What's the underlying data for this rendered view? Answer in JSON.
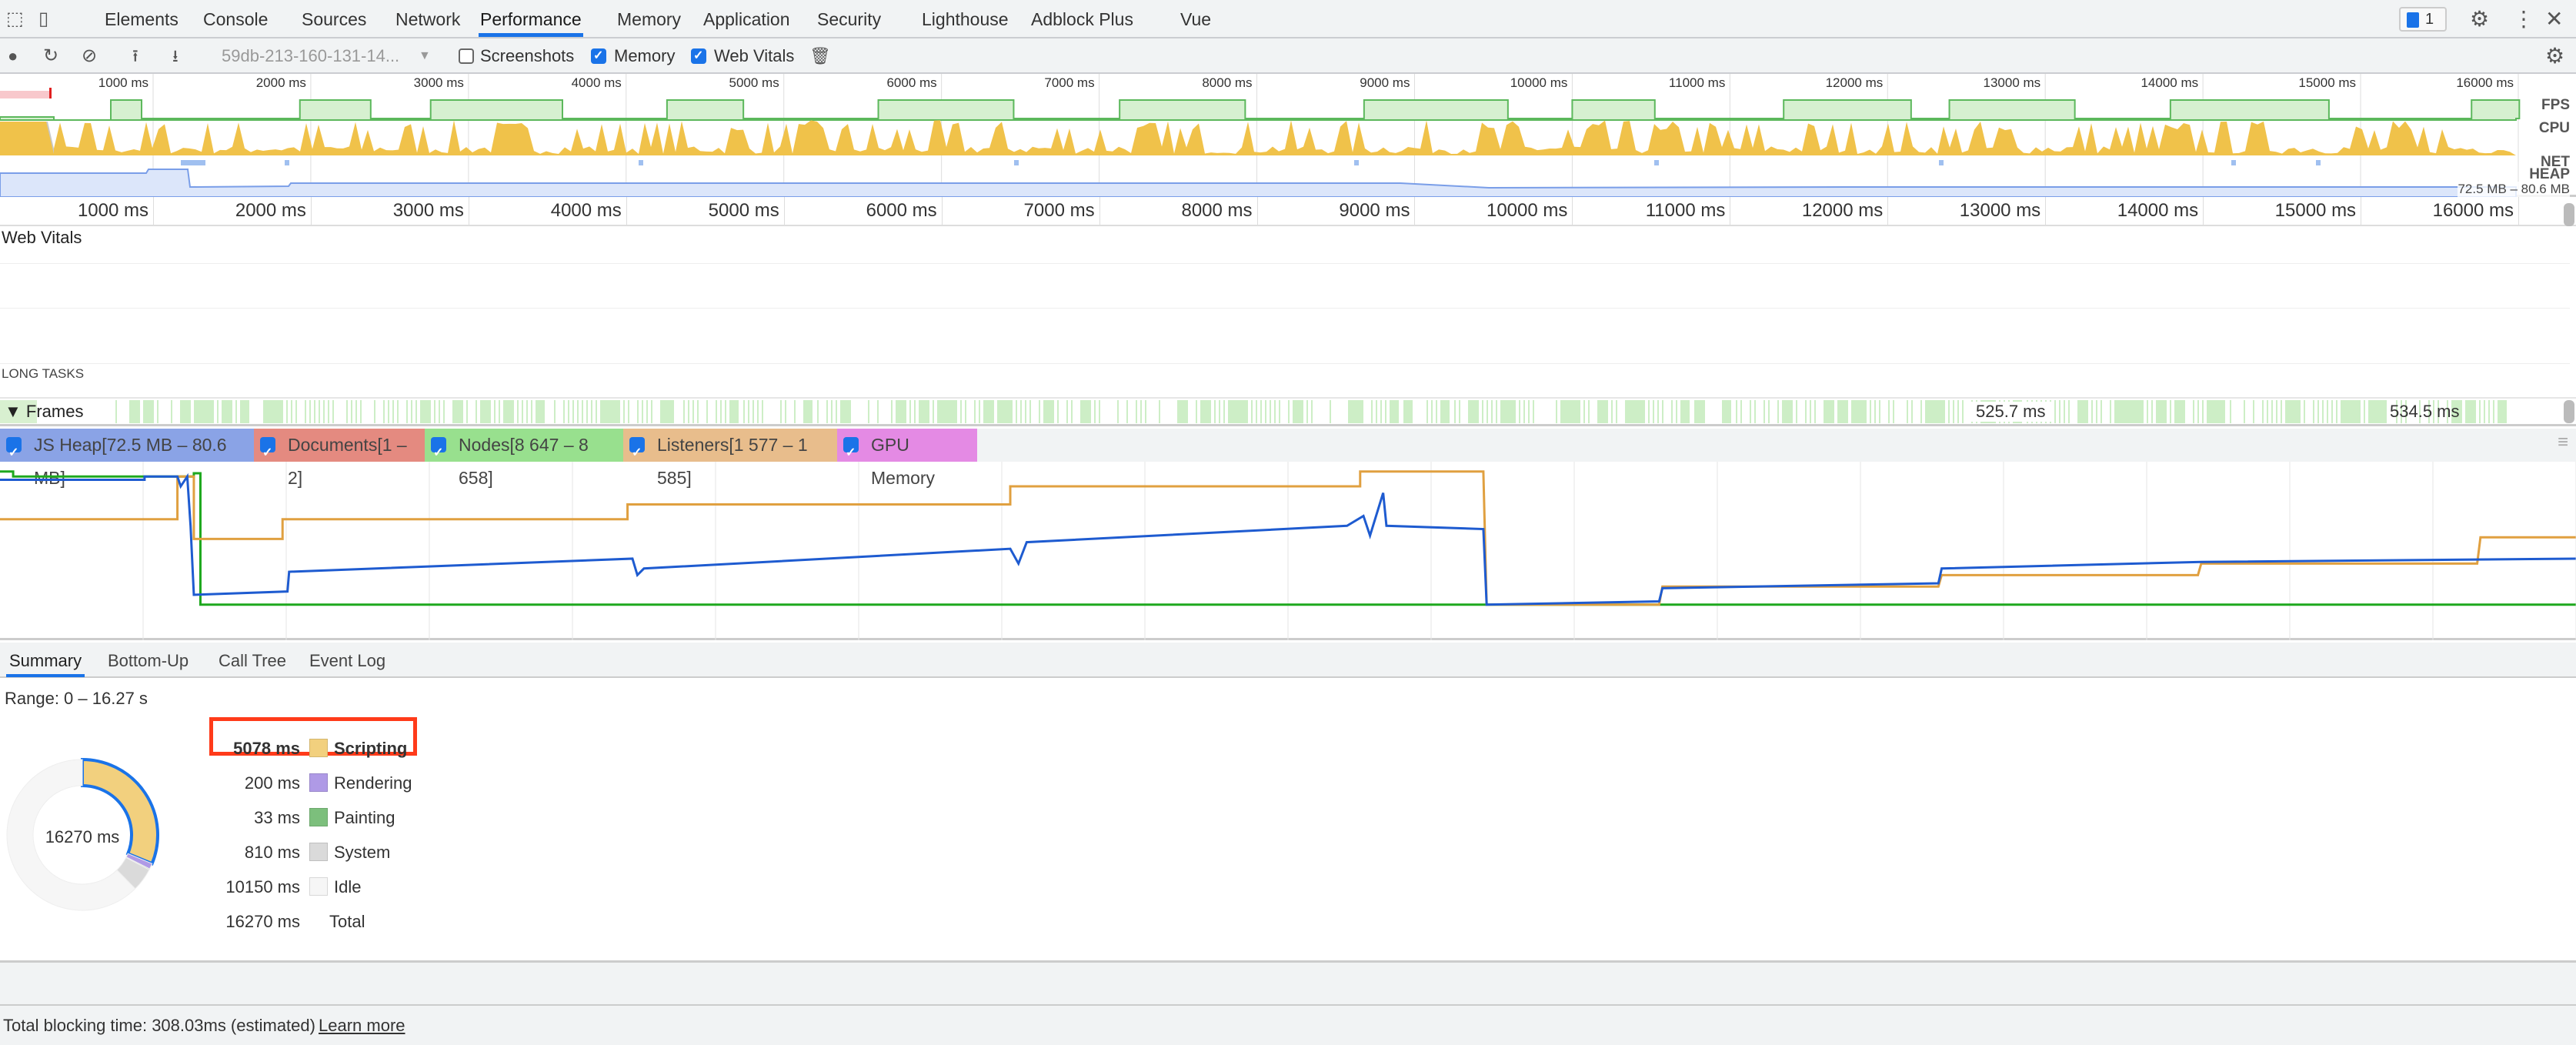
{
  "devtools_tabs": [
    "Elements",
    "Console",
    "Sources",
    "Network",
    "Performance",
    "Memory",
    "Application",
    "Security",
    "Lighthouse",
    "Adblock Plus",
    "Vue"
  ],
  "active_tab": "Performance",
  "issues_badge": "1",
  "toolbar": {
    "profile_select": "59db-213-160-131-14...",
    "screenshots_label": "Screenshots",
    "screenshots_checked": false,
    "memory_label": "Memory",
    "memory_checked": true,
    "web_vitals_label": "Web Vitals",
    "web_vitals_checked": true
  },
  "overview": {
    "ticks": [
      "1000 ms",
      "2000 ms",
      "3000 ms",
      "4000 ms",
      "5000 ms",
      "6000 ms",
      "7000 ms",
      "8000 ms",
      "9000 ms",
      "10000 ms",
      "11000 ms",
      "12000 ms",
      "13000 ms",
      "14000 ms",
      "15000 ms",
      "16000 ms"
    ],
    "tracks": {
      "fps": "FPS",
      "cpu": "CPU",
      "net": "NET",
      "heap": "HEAP"
    },
    "heap_range": "72.5 MB – 80.6 MB",
    "colors": {
      "fps": "#5cb85c",
      "scripting": "#f0c24a",
      "system": "#c8c8c8",
      "heap": "#7a9ee8"
    }
  },
  "main": {
    "ticks": [
      "1000 ms",
      "2000 ms",
      "3000 ms",
      "4000 ms",
      "5000 ms",
      "6000 ms",
      "7000 ms",
      "8000 ms",
      "9000 ms",
      "10000 ms",
      "11000 ms",
      "12000 ms",
      "13000 ms",
      "14000 ms",
      "15000 ms",
      "16000 ms"
    ],
    "web_vitals_label": "Web Vitals",
    "long_tasks_label": "LONG TASKS",
    "frames_label": "Frames",
    "frame_durations": [
      "525.7 ms",
      "534.5 ms"
    ]
  },
  "memory_counters": [
    {
      "label": "JS Heap[72.5 MB – 80.6 MB]",
      "color": "#8aa3e6",
      "line": "#1e5bd0",
      "checked": true
    },
    {
      "label": "Documents[1 – 2]",
      "color": "#e48a80",
      "line": "#d0443a",
      "checked": true
    },
    {
      "label": "Nodes[8 647 – 8 658]",
      "color": "#98e08e",
      "line": "#1ea81e",
      "checked": true
    },
    {
      "label": "Listeners[1 577 – 1 585]",
      "color": "#e8bd8c",
      "line": "#e0a040",
      "checked": true
    },
    {
      "label": "GPU Memory",
      "color": "#e48ae4",
      "line": "#c040c0",
      "checked": true
    }
  ],
  "summary": {
    "tabs": [
      "Summary",
      "Bottom-Up",
      "Call Tree",
      "Event Log"
    ],
    "active_tab": "Summary",
    "range": "Range: 0 – 16.27 s",
    "donut_center": "16270 ms",
    "rows": [
      {
        "value": "5078 ms",
        "label": "Scripting",
        "ms": 5078,
        "color": "#f2d07e",
        "highlighted": true
      },
      {
        "value": "200 ms",
        "label": "Rendering",
        "ms": 200,
        "color": "#af9ae6"
      },
      {
        "value": "33 ms",
        "label": "Painting",
        "ms": 33,
        "color": "#7cbf7c"
      },
      {
        "value": "810 ms",
        "label": "System",
        "ms": 810,
        "color": "#dadada"
      },
      {
        "value": "10150 ms",
        "label": "Idle",
        "ms": 10150,
        "color": "#f6f6f6"
      },
      {
        "value": "16270 ms",
        "label": "Total"
      }
    ],
    "highlight_color": "#ff3b1a"
  },
  "footer": {
    "tbt": "Total blocking time: 308.03ms (estimated)",
    "learn_more": "Learn more"
  }
}
